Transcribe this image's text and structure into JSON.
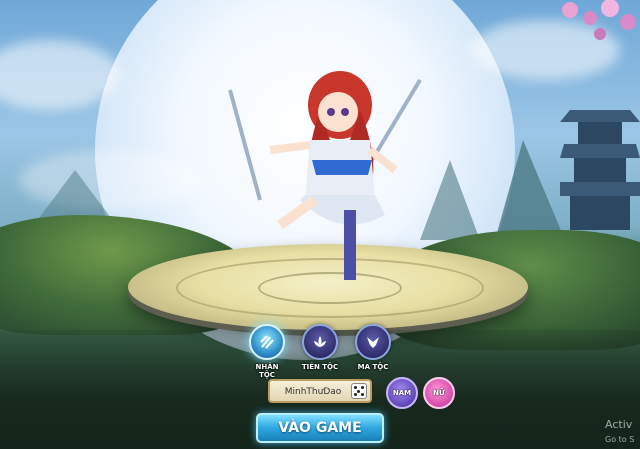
{
  "races": [
    {
      "label": "NHÂN TỘC",
      "icon": "fist-icon",
      "selected": true
    },
    {
      "label": "TIÊN TỘC",
      "icon": "lotus-icon",
      "selected": false
    },
    {
      "label": "MA TỘC",
      "icon": "demon-icon",
      "selected": false
    }
  ],
  "name_input": {
    "value": "MinhThưDao"
  },
  "gender": {
    "male_label": "NAM",
    "female_label": "NỮ"
  },
  "play_button": {
    "label": "VÀO GAME"
  },
  "watermark": {
    "line1": "Activ",
    "line2": "Go to S"
  },
  "colors": {
    "accent": "#2fa8df",
    "male": "#5d45b8",
    "female": "#d548a8",
    "platform": "#e7dfa3"
  }
}
